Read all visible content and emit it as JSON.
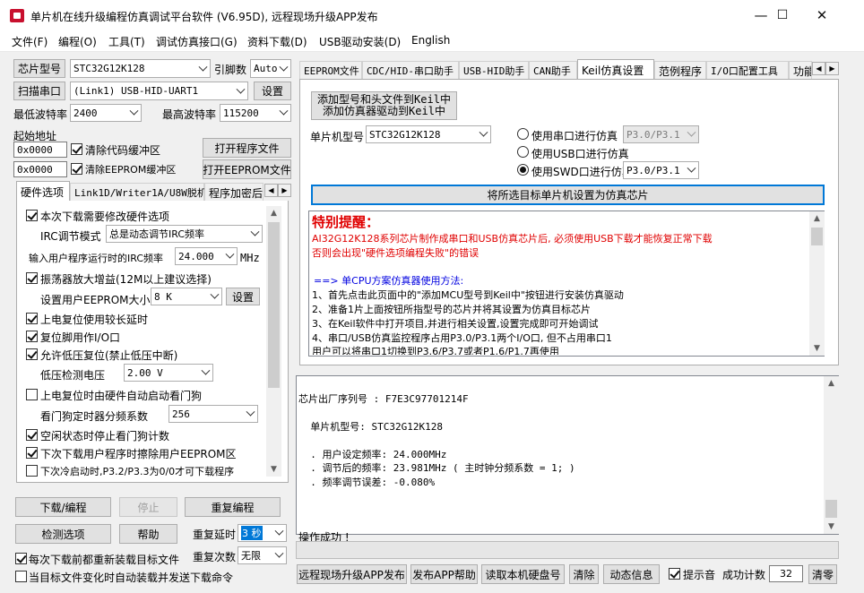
{
  "window": {
    "title": "单片机在线升级编程仿真调试平台软件 (V6.95D), 远程现场升级APP发布",
    "minimize": "—",
    "maximize": "☐",
    "close": "✕"
  },
  "menu": [
    "文件(F)",
    "编程(O)",
    "工具(T)",
    "调试仿真接口(G)",
    "资料下载(D)",
    "USB驱动安装(D)",
    "English"
  ],
  "left": {
    "chip_btn": "芯片型号",
    "chip_value": "STC32G12K128",
    "pin_label": "引脚数",
    "pin_value": "Auto",
    "scan_btn": "扫描串口",
    "port_value": "(Link1) USB-HID-UART1",
    "settings_btn": "设置",
    "min_baud_label": "最低波特率",
    "min_baud_value": "2400",
    "max_baud_label": "最高波特率",
    "max_baud_value": "115200",
    "start_addr_label": "起始地址",
    "addr1": "0x0000",
    "clear_code": "清除代码缓冲区",
    "open_prog": "打开程序文件",
    "addr2": "0x0000",
    "clear_eeprom": "清除EEPROM缓冲区",
    "open_eeprom": "打开EEPROM文件",
    "tabs": [
      "硬件选项",
      "Link1D/Writer1A/U8W脱机",
      "程序加密后"
    ],
    "opt_modify": "本次下载需要修改硬件选项",
    "irc_mode_label": "IRC调节模式",
    "irc_mode_value": "总是动态调节IRC频率",
    "irc_freq_label": "输入用户程序运行时的IRC频率",
    "irc_freq_value": "24.000",
    "irc_unit": "MHz",
    "osc_gain": "振荡器放大增益(12M以上建议选择)",
    "eeprom_size_label": "设置用户EEPROM大小",
    "eeprom_size_value": "8   K",
    "eeprom_set_btn": "设置",
    "long_delay": "上电复位使用较长延时",
    "reset_io": "复位脚用作I/O口",
    "lvr": "允许低压复位(禁止低压中断)",
    "lv_label": "低压检测电压",
    "lv_value": "2.00 V",
    "wdt_auto": "上电复位时由硬件自动启动看门狗",
    "wdt_div_label": "看门狗定时器分频系数",
    "wdt_div_value": "256",
    "idle_wdt": "空闲状态时停止看门狗计数",
    "erase_eeprom": "下次下载用户程序时擦除用户EEPROM区",
    "next_cold": "下次冷启动时,P3.2/P3.3为0/0才可下载程序",
    "download_btn": "下载/编程",
    "stop_btn": "停止",
    "reprog_btn": "重复编程",
    "detect_btn": "检测选项",
    "help_btn": "帮助",
    "repeat_delay_label": "重复延时",
    "repeat_delay_value": "3 秒",
    "repeat_count_label": "重复次数",
    "repeat_count_value": "无限",
    "reload_each": "每次下载前都重新装载目标文件",
    "auto_send": "当目标文件变化时自动装载并发送下载命令"
  },
  "right": {
    "tabs": [
      "EEPROM文件",
      "CDC/HID-串口助手",
      "USB-HID助手",
      "CAN助手",
      "Keil仿真设置",
      "范例程序",
      "I/O口配置工具",
      "功能"
    ],
    "add_keil_btn_l1": "添加型号和头文件到Keil中",
    "add_keil_btn_l2": "添加仿真器驱动到Keil中",
    "chip_label": "单片机型号",
    "chip_value": "STC32G12K128",
    "radio_uart": "使用串口进行仿真",
    "radio_uart_port": "P3.0/P3.1",
    "radio_usb": "使用USB口进行仿真",
    "radio_swd": "使用SWD口进行仿真",
    "radio_swd_port": "P3.0/P3.1",
    "set_target_btn": "将所选目标单片机设置为仿真芯片",
    "notice_title": "特别提醒：",
    "notice_l1": "AI32G12K128系列芯片制作成串口和USB仿真芯片后, 必须使用USB下载才能恢复正常下载",
    "notice_l2": "否则会出现\"硬件选项编程失败\"的错误",
    "method_title": "==> 单CPU方案仿真器使用方法:",
    "steps": [
      "1、首先点击此页面中的\"添加MCU型号到Keil中\"按钮进行安装仿真驱动",
      "2、准备1片上面按钮所指型号的芯片并将其设置为仿真目标芯片",
      "3、在Keil软件中打开项目,并进行相关设置,设置完成即可开始调试",
      "4、串口/USB仿真监控程序占用P3.0/P3.1两个I/O口, 但不占用串口1",
      "    用户可以将串口1切换到P3.6/P3.7或者P1.6/P1.7再使用"
    ]
  },
  "log": {
    "lines": [
      "芯片出厂序列号 : F7E3C97701214F",
      "",
      "  单片机型号: STC32G12K128",
      "",
      "  . 用户设定频率: 24.000MHz",
      "  . 调节后的频率: 23.981MHz ( 主时钟分频系数 = 1; )",
      "  . 频率调节误差: -0.080%",
      "",
      "",
      "",
      "操作成功 !"
    ]
  },
  "bottom": {
    "remote_btn": "远程现场升级APP发布",
    "publish_help_btn": "发布APP帮助",
    "read_disk_btn": "读取本机硬盘号",
    "clear_btn": "清除",
    "anim_btn": "动态信息",
    "beep_label": "提示音",
    "success_label": "成功计数",
    "success_value": "32",
    "reset_btn": "清零"
  }
}
